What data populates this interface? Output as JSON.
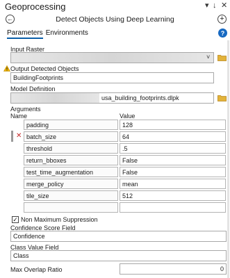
{
  "window": {
    "title": "Geoprocessing",
    "pin_symbol": "▾",
    "autohide_symbol": "↓",
    "close_symbol": "✕"
  },
  "header": {
    "tool_name": "Detect Objects Using Deep Learning",
    "back_symbol": "←",
    "add_symbol": "+"
  },
  "tabs": [
    {
      "label": "Parameters",
      "active": true
    },
    {
      "label": "Environments",
      "active": false
    }
  ],
  "help_symbol": "?",
  "input_raster": {
    "label": "Input Raster",
    "value": "",
    "dropdown_symbol": "˅"
  },
  "output_objects": {
    "label": "Output Detected Objects",
    "value": "BuildingFootprints",
    "warning": "!"
  },
  "model_definition": {
    "label": "Model Definition",
    "value": "usa_building_footprints.dlpk"
  },
  "arguments": {
    "label": "Arguments",
    "col_name": "Name",
    "col_value": "Value",
    "error_symbol": "✕",
    "rows": [
      {
        "name": "padding",
        "value": "128"
      },
      {
        "name": "batch_size",
        "value": "64"
      },
      {
        "name": "threshold",
        "value": ".5"
      },
      {
        "name": "return_bboxes",
        "value": "False"
      },
      {
        "name": "test_time_augmentation",
        "value": "False"
      },
      {
        "name": "merge_policy",
        "value": "mean"
      },
      {
        "name": "tile_size",
        "value": "512"
      },
      {
        "name": "",
        "value": ""
      }
    ]
  },
  "nms": {
    "label": "Non Maximum Suppression",
    "checked": true,
    "check_symbol": "✓"
  },
  "confidence_field": {
    "label": "Confidence Score Field",
    "value": "Confidence"
  },
  "class_value_field": {
    "label": "Class Value Field",
    "value": "Class"
  },
  "max_overlap": {
    "label": "Max Overlap Ratio",
    "value": "0"
  },
  "colors": {
    "accent": "#1769c2",
    "folder": "#d9a520",
    "warning": "#e0a800",
    "error": "#c62828"
  }
}
